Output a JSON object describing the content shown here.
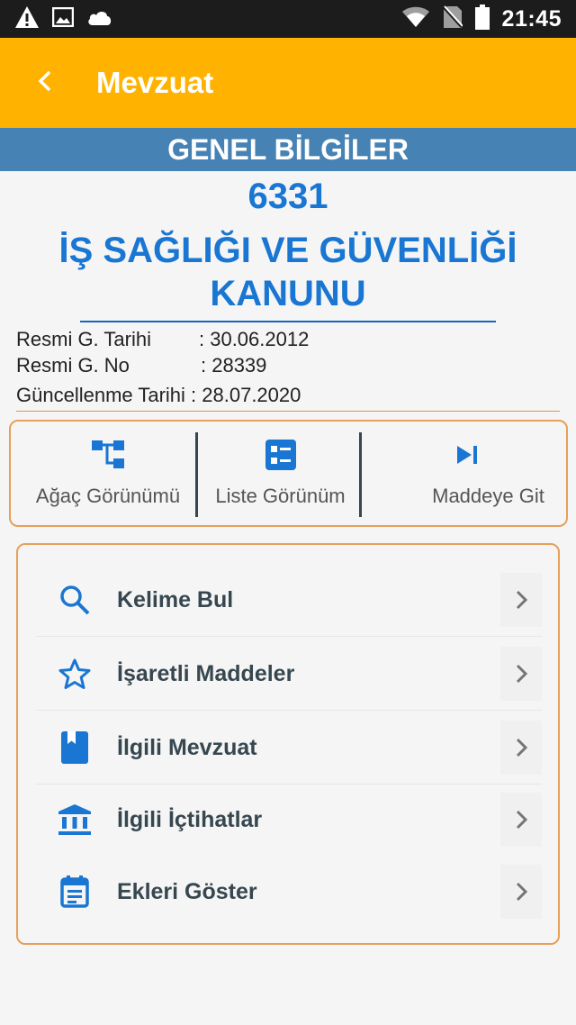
{
  "status_bar": {
    "time": "21:45",
    "icons": [
      "warning-icon",
      "image-icon",
      "cloud-icon",
      "wifi-icon",
      "no-sim-icon",
      "battery-icon"
    ]
  },
  "app_bar": {
    "title": "Mevzuat",
    "back_icon": "chevron-left-icon",
    "color": "#ffb300"
  },
  "section": {
    "title": "GENEL BİLGİLER",
    "color": "#4682b4"
  },
  "law": {
    "number": "6331",
    "title": "İŞ SAĞLIĞI VE GÜVENLİĞİ KANUNU",
    "color": "#1976d2"
  },
  "info": [
    {
      "label": "Resmi G. Tarihi",
      "value": ": 30.06.2012"
    },
    {
      "label": "Resmi G. No",
      "value": ": 28339"
    },
    {
      "label": "Güncellenme Tarihi",
      "value": " : 28.07.2020"
    }
  ],
  "views": [
    {
      "label": "Ağaç Görünümü",
      "icon": "tree-view-icon"
    },
    {
      "label": "Liste Görünüm",
      "icon": "list-view-icon"
    },
    {
      "label": "Maddeye Git",
      "icon": "skip-next-icon"
    }
  ],
  "menu": [
    {
      "label": "Kelime Bul",
      "icon": "search-icon"
    },
    {
      "label": "İşaretli Maddeler",
      "icon": "star-icon"
    },
    {
      "label": "İlgili Mevzuat",
      "icon": "book-icon"
    },
    {
      "label": "İlgili İçtihatlar",
      "icon": "institution-icon"
    },
    {
      "label": "Ekleri Göster",
      "icon": "calendar-note-icon"
    }
  ],
  "accent_colors": {
    "card_border": "#e6a05a",
    "icon_blue": "#1976d2"
  }
}
